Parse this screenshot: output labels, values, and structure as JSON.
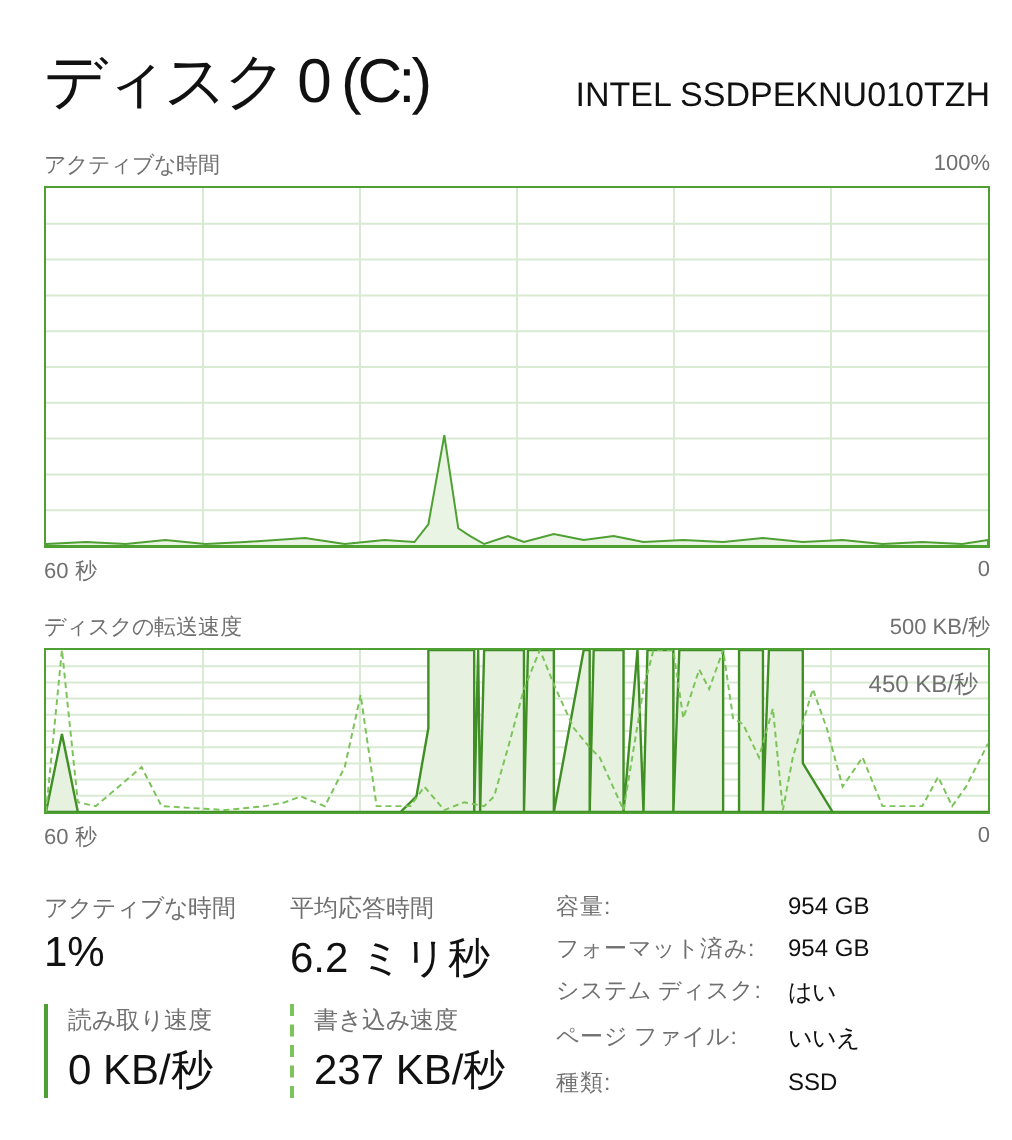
{
  "header": {
    "title": "ディスク 0 (C:)",
    "model": "INTEL SSDPEKNU010TZH"
  },
  "charts": [
    {
      "kind": "active",
      "title": "アクティブな時間",
      "max_label": "100%",
      "time_label": "60 秒",
      "end_label": "0"
    },
    {
      "kind": "transfer",
      "title": "ディスクの転送速度",
      "max_label": "500 KB/秒",
      "inner_label": "450 KB/秒",
      "time_label": "60 秒",
      "end_label": "0"
    }
  ],
  "stats": [
    {
      "kind": "plain",
      "label": "アクティブな時間",
      "value": "1%"
    },
    {
      "kind": "plain",
      "label": "平均応答時間",
      "value": "6.2 ミリ秒"
    },
    {
      "kind": "read",
      "label": "読み取り速度",
      "value": "0 KB/秒"
    },
    {
      "kind": "write",
      "label": "書き込み速度",
      "value": "237 KB/秒"
    }
  ],
  "properties": [
    {
      "label": "容量:",
      "value": "954 GB"
    },
    {
      "label": "フォーマット済み:",
      "value": "954 GB"
    },
    {
      "label": "システム ディスク:",
      "value": "はい"
    },
    {
      "label": "ページ ファイル:",
      "value": "いいえ"
    },
    {
      "label": "種類:",
      "value": "SSD"
    }
  ]
}
